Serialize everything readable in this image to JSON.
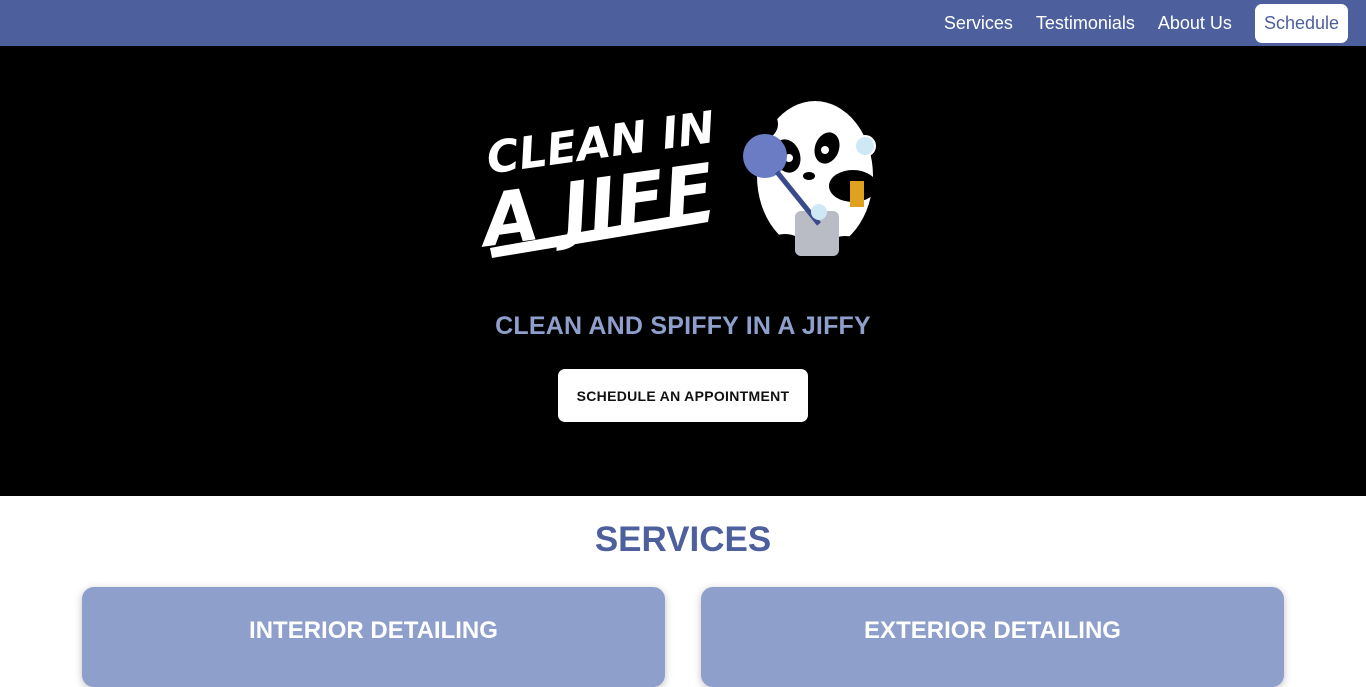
{
  "nav": {
    "links": [
      "Services",
      "Testimonials",
      "About Us"
    ],
    "schedule_label": "Schedule"
  },
  "hero": {
    "logo_alt": "CLEAN IN A JIFF",
    "tagline": "CLEAN AND SPIFFY IN A JIFFY",
    "cta_label": "SCHEDULE AN APPOINTMENT"
  },
  "services": {
    "title": "SERVICES",
    "cards": [
      {
        "title": "INTERIOR DETAILING"
      },
      {
        "title": "EXTERIOR DETAILING"
      }
    ]
  },
  "colors": {
    "brand": "#4d5f9c",
    "card": "#8f9fcb",
    "tagline": "#8e9fcc"
  }
}
